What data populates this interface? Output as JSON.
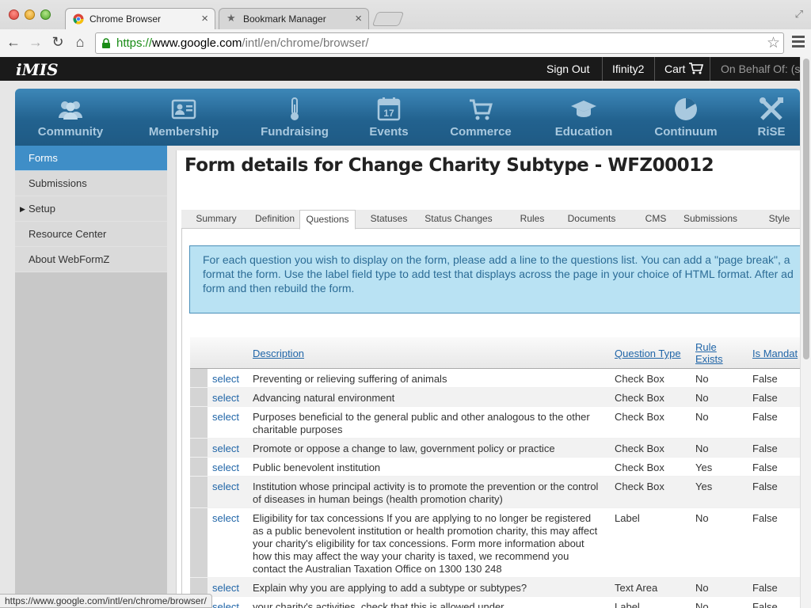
{
  "browser": {
    "tabs": [
      {
        "title": "Chrome Browser",
        "icon": "chrome-icon"
      },
      {
        "title": "Bookmark Manager",
        "icon": "star-icon"
      }
    ],
    "url": {
      "scheme": "https://",
      "host": "www.google.com",
      "path": "/intl/en/chrome/browser/"
    },
    "status_url": "https://www.google.com/intl/en/chrome/browser/"
  },
  "imis": {
    "logo": "iMIS",
    "topnav": {
      "sign_out": "Sign Out",
      "user": "Ifinity2",
      "cart": "Cart",
      "on_behalf": "On Behalf Of: (s"
    },
    "mainnav": [
      {
        "label": "Community",
        "icon": "people-icon"
      },
      {
        "label": "Membership",
        "icon": "id-card-icon"
      },
      {
        "label": "Fundraising",
        "icon": "thermometer-icon"
      },
      {
        "label": "Events",
        "icon": "calendar-icon"
      },
      {
        "label": "Commerce",
        "icon": "cart-icon"
      },
      {
        "label": "Education",
        "icon": "graduation-cap-icon"
      },
      {
        "label": "Continuum",
        "icon": "pie-chart-icon"
      },
      {
        "label": "RiSE",
        "icon": "tools-icon"
      }
    ],
    "calendar_day": "17"
  },
  "sidebar": {
    "items": [
      {
        "label": "Forms",
        "active": true
      },
      {
        "label": "Submissions"
      },
      {
        "label": "Setup",
        "expandable": true
      },
      {
        "label": "Resource Center"
      },
      {
        "label": "About WebFormZ"
      }
    ]
  },
  "page": {
    "title": "Form details for Change Charity Subtype - WFZ00012",
    "tabs": [
      "Summary",
      "Definition",
      "Questions",
      "Statuses",
      "Status Changes",
      "Rules",
      "Documents",
      "CMS",
      "Submissions",
      "Style"
    ],
    "active_tab": "Questions",
    "info_lines": [
      "For each question you wish to display on the form, please add a line to the questions list. You can add a \"page break\", a",
      "format the form. Use the label field type to add test that displays across the page in your choice of HTML format. After ad",
      "form and then rebuild the form."
    ]
  },
  "grid": {
    "headers": {
      "description": "Description",
      "question_type": "Question Type",
      "rule_exists_1": "Rule",
      "rule_exists_2": "Exists",
      "is_mandatory": "Is Mandat"
    },
    "select_label": "select",
    "rows": [
      {
        "desc": [
          "Preventing or relieving suffering of animals"
        ],
        "type": "Check Box",
        "rule": "No",
        "mand": "False"
      },
      {
        "desc": [
          "Advancing natural environment"
        ],
        "type": "Check Box",
        "rule": "No",
        "mand": "False"
      },
      {
        "desc": [
          "Purposes beneficial to the general public and other analogous to the other",
          "charitable purposes"
        ],
        "type": "Check Box",
        "rule": "No",
        "mand": "False"
      },
      {
        "desc": [
          "Promote or oppose a change to law, government policy or practice"
        ],
        "type": "Check Box",
        "rule": "No",
        "mand": "False"
      },
      {
        "desc": [
          "Public benevolent institution"
        ],
        "type": "Check Box",
        "rule": "Yes",
        "mand": "False"
      },
      {
        "desc": [
          "Institution whose principal activity is to promote the prevention or the control",
          "of diseases in human beings (health promotion charity)"
        ],
        "type": "Check Box",
        "rule": "Yes",
        "mand": "False"
      },
      {
        "desc": [
          "Eligibility for tax concessions If you are applying to no longer be registered",
          "as a public benevolent institution or health promotion charity, this may affect",
          "your charity's eligibility for tax concessions. Form more information about",
          "how this may affect the way your charity is taxed, we recommend you",
          "contact the Australian Taxation Office on 1300 130 248"
        ],
        "type": "Label",
        "rule": "No",
        "mand": "False"
      },
      {
        "desc": [
          "Explain why you are applying to add a subtype or subtypes?"
        ],
        "type": "Text Area",
        "rule": "No",
        "mand": "False"
      },
      {
        "desc": [
          "your charity's activities, check that this is allowed under"
        ],
        "type": "Label",
        "rule": "No",
        "mand": "False"
      }
    ]
  }
}
